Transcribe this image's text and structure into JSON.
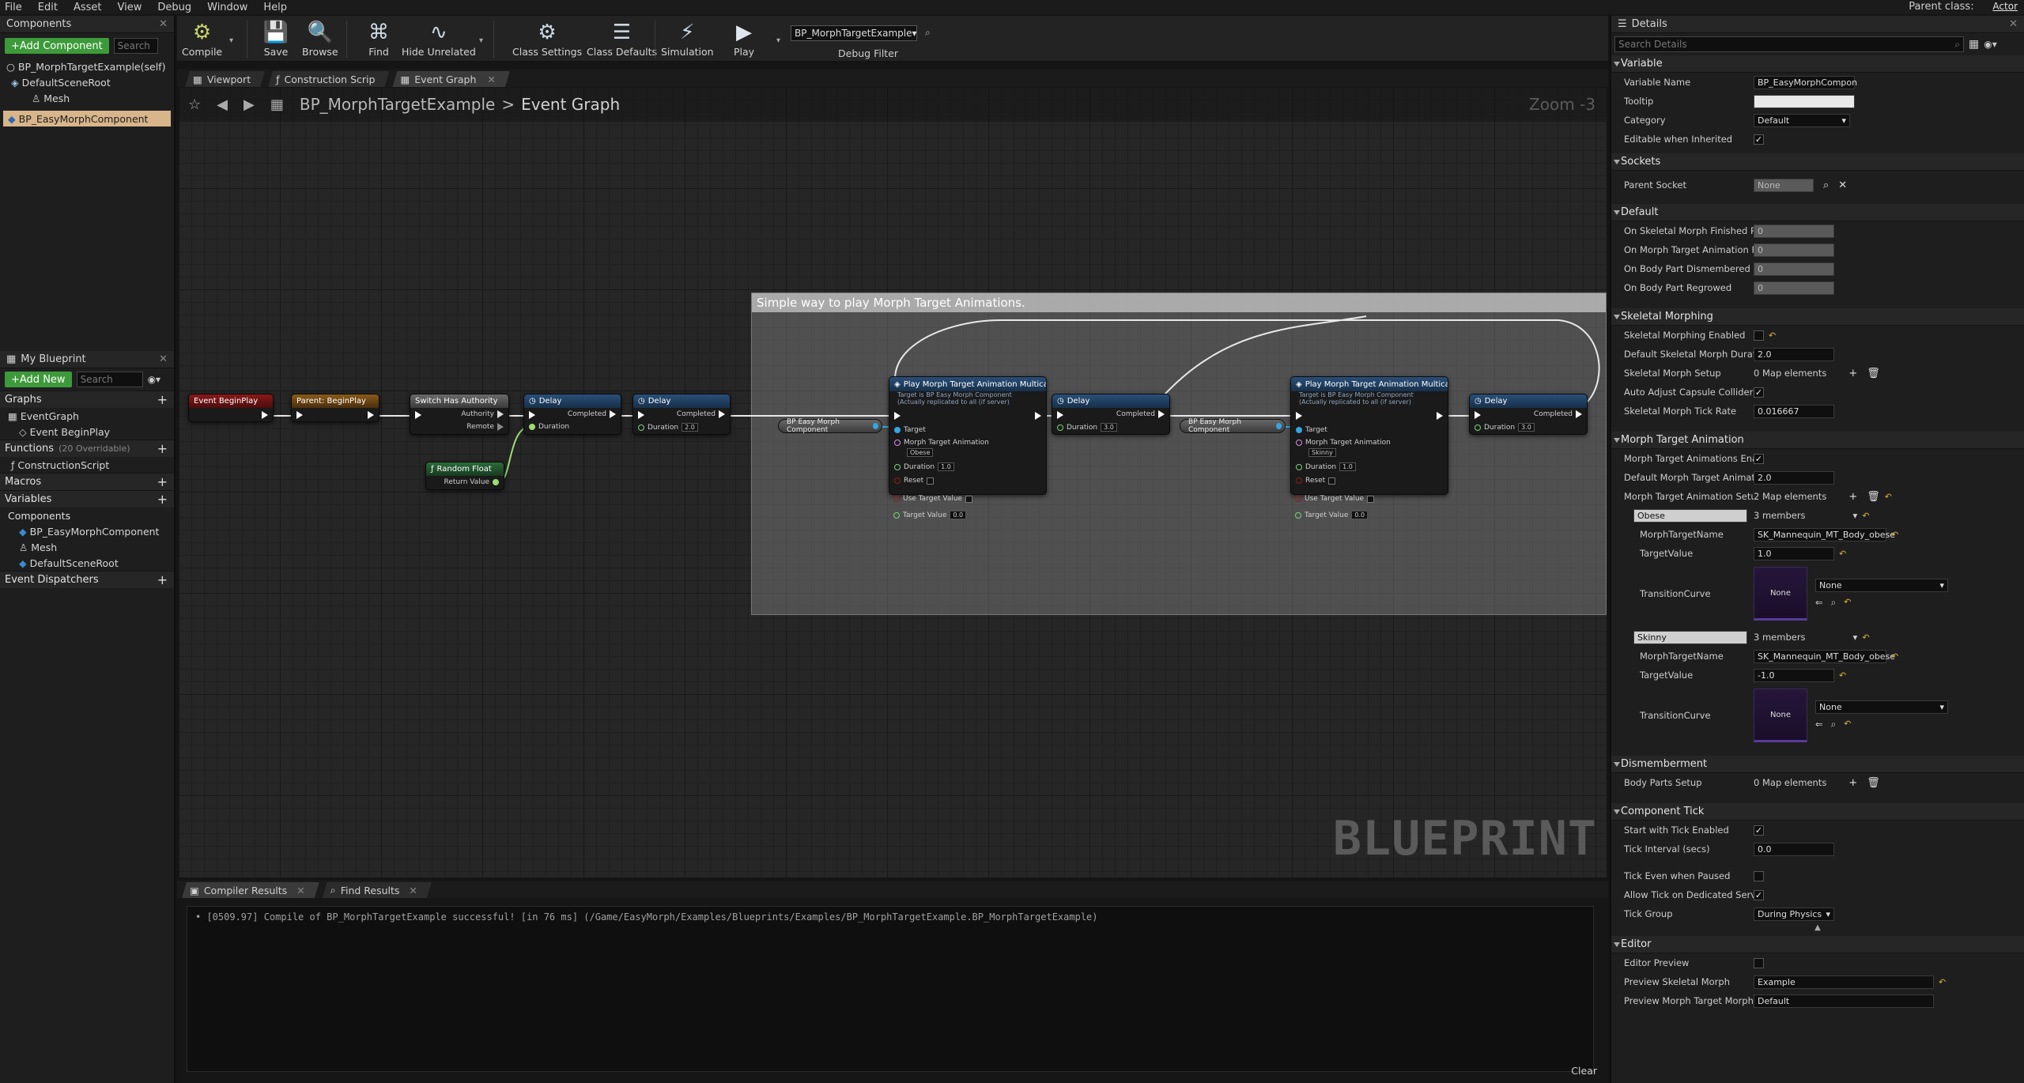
{
  "menu": [
    "File",
    "Edit",
    "Asset",
    "View",
    "Debug",
    "Window",
    "Help"
  ],
  "parent_class": {
    "label": "Parent class:",
    "value": "Actor"
  },
  "components_panel": {
    "title": "Components",
    "add_button": "+Add Component",
    "search_placeholder": "Search",
    "items": [
      {
        "label": "BP_MorphTargetExample(self)"
      },
      {
        "label": "DefaultSceneRoot"
      },
      {
        "label": "Mesh"
      },
      {
        "label": "BP_EasyMorphComponent"
      }
    ]
  },
  "my_blueprint": {
    "title": "My Blueprint",
    "add_button": "+Add New",
    "search_placeholder": "Search",
    "graphs_label": "Graphs",
    "event_graph": "EventGraph",
    "event_begin_play": "Event BeginPlay",
    "functions_label": "Functions",
    "functions_sub": "(20 Overridable)",
    "construction_script": "ConstructionScript",
    "macros_label": "Macros",
    "variables_label": "Variables",
    "components_label": "Components",
    "components": [
      "BP_EasyMorphComponent",
      "Mesh",
      "DefaultSceneRoot"
    ],
    "dispatchers_label": "Event Dispatchers"
  },
  "toolbar": {
    "compile": "Compile",
    "save": "Save",
    "browse": "Browse",
    "find": "Find",
    "hide_unrelated": "Hide Unrelated",
    "class_settings": "Class Settings",
    "class_defaults": "Class Defaults",
    "simulation": "Simulation",
    "play": "Play",
    "debug_object": "BP_MorphTargetExample",
    "debug_filter": "Debug Filter"
  },
  "editor_tabs": [
    "Viewport",
    "Construction Scrip",
    "Event Graph"
  ],
  "graph": {
    "breadcrumb_root": "BP_MorphTargetExample",
    "breadcrumb_sep": ">",
    "breadcrumb_leaf": "Event Graph",
    "zoom": "Zoom -3",
    "watermark": "BLUEPRINT",
    "comment": "Simple way to play Morph Target Animations.",
    "nodes": {
      "begin_play": "Event BeginPlay",
      "parent_begin_play": "Parent: BeginPlay",
      "switch_authority": "Switch Has Authority",
      "authority": "Authority",
      "remote": "Remote",
      "delay": "Delay",
      "completed": "Completed",
      "duration": "Duration",
      "delay_val": "2.0",
      "delay_val_b": "3.0",
      "delay_val_c": "3.0",
      "random_float": "Random Float",
      "return_value": "Return Value",
      "component_var": "BP Easy Morph Component",
      "play_multicast": "Play Morph Target Animation Multicast",
      "multicast_sub1": "Target is BP Easy Morph Component",
      "multicast_sub2": "(Actually replicated to all (if server)",
      "target": "Target",
      "morph_anim": "Morph Target Animation",
      "morph_obese": "Obese",
      "morph_skinny": "Skinny",
      "duration_val": "1.0",
      "reset": "Reset",
      "use_target": "Use Target Value",
      "target_value": "Target Value",
      "target_value_val": "0.0"
    }
  },
  "bottom": {
    "tab_compiler": "Compiler Results",
    "tab_find": "Find Results",
    "log_line": "[0509.97] Compile of BP_MorphTargetExample successful! [in 76 ms] (/Game/EasyMorph/Examples/Blueprints/Examples/BP_MorphTargetExample.BP_MorphTargetExample)",
    "clear": "Clear"
  },
  "details": {
    "title": "Details",
    "search_placeholder": "Search Details",
    "variable": "Variable",
    "variable_name_label": "Variable Name",
    "variable_name": "BP_EasyMorphCompon",
    "tooltip_label": "Tooltip",
    "category_label": "Category",
    "category": "Default",
    "editable_label": "Editable when Inherited",
    "sockets": "Sockets",
    "parent_socket_label": "Parent Socket",
    "parent_socket": "None",
    "default": "Default",
    "default_rows": [
      "On Skeletal Morph Finished Play",
      "On Morph Target Animation Fini",
      "On Body Part Dismembered",
      "On Body Part Regrowed"
    ],
    "zero": "0",
    "skeletal": "Skeletal Morphing",
    "skel_enabled": "Skeletal Morphing Enabled",
    "skel_duration_label": "Default Skeletal Morph Duration",
    "skel_duration": "2.0",
    "skel_setup_label": "Skeletal Morph Setup",
    "map_elements_0": "0 Map elements",
    "auto_adjust": "Auto Adjust Capsule Collider",
    "tick_rate_label": "Skeletal Morph Tick Rate",
    "tick_rate": "0.016667",
    "mta": "Morph Target Animation",
    "mta_enabled": "Morph Target Animations Enable",
    "mta_duration_label": "Default Morph Target Animation",
    "mta_duration": "2.0",
    "mta_setup_label": "Morph Target Animation Setup",
    "map_elements_2": "2 Map elements",
    "entry1_key": "Obese",
    "entry2_key": "Skinny",
    "members": "3 members",
    "morph_name_label": "MorphTargetName",
    "morph_name": "SK_Mannequin_MT_Body_obese",
    "target_value_label": "TargetValue",
    "target_value_1": "1.0",
    "target_value_2": "-1.0",
    "transition_label": "TransitionCurve",
    "none": "None",
    "dismember": "Dismemberment",
    "body_parts_label": "Body Parts Setup",
    "component_tick": "Component Tick",
    "tick_enabled": "Start with Tick Enabled",
    "tick_interval_label": "Tick Interval (secs)",
    "tick_interval": "0.0",
    "tick_paused": "Tick Even when Paused",
    "tick_server": "Allow Tick on Dedicated Server",
    "tick_group_label": "Tick Group",
    "tick_group": "During Physics",
    "editor": "Editor",
    "editor_preview": "Editor Preview",
    "preview_skel_label": "Preview Skeletal Morph",
    "preview_skel": "Example",
    "preview_mt_label": "Preview Morph Target Morph",
    "preview_mt": "Default"
  }
}
